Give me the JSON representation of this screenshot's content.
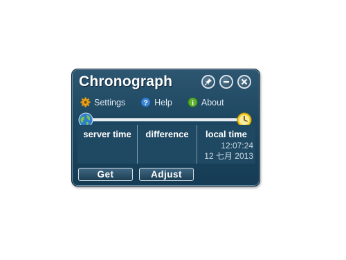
{
  "app": {
    "title": "Chronograph"
  },
  "window_controls": {
    "pin": "pin-icon",
    "minimize": "minimize-icon",
    "close": "close-icon"
  },
  "menu": {
    "items": [
      {
        "label": "Settings",
        "icon": "gear-icon"
      },
      {
        "label": "Help",
        "icon": "help-icon"
      },
      {
        "label": "About",
        "icon": "info-icon"
      }
    ]
  },
  "columns": {
    "server": {
      "header": "server time"
    },
    "difference": {
      "header": "difference"
    },
    "local": {
      "header": "local time",
      "time": "12:07:24",
      "date": "12 七月 2013"
    }
  },
  "buttons": {
    "get": "Get",
    "adjust": "Adjust"
  },
  "colors": {
    "panel": "#1d4660",
    "accent_light": "#e7eef3",
    "text": "#ffffff"
  }
}
